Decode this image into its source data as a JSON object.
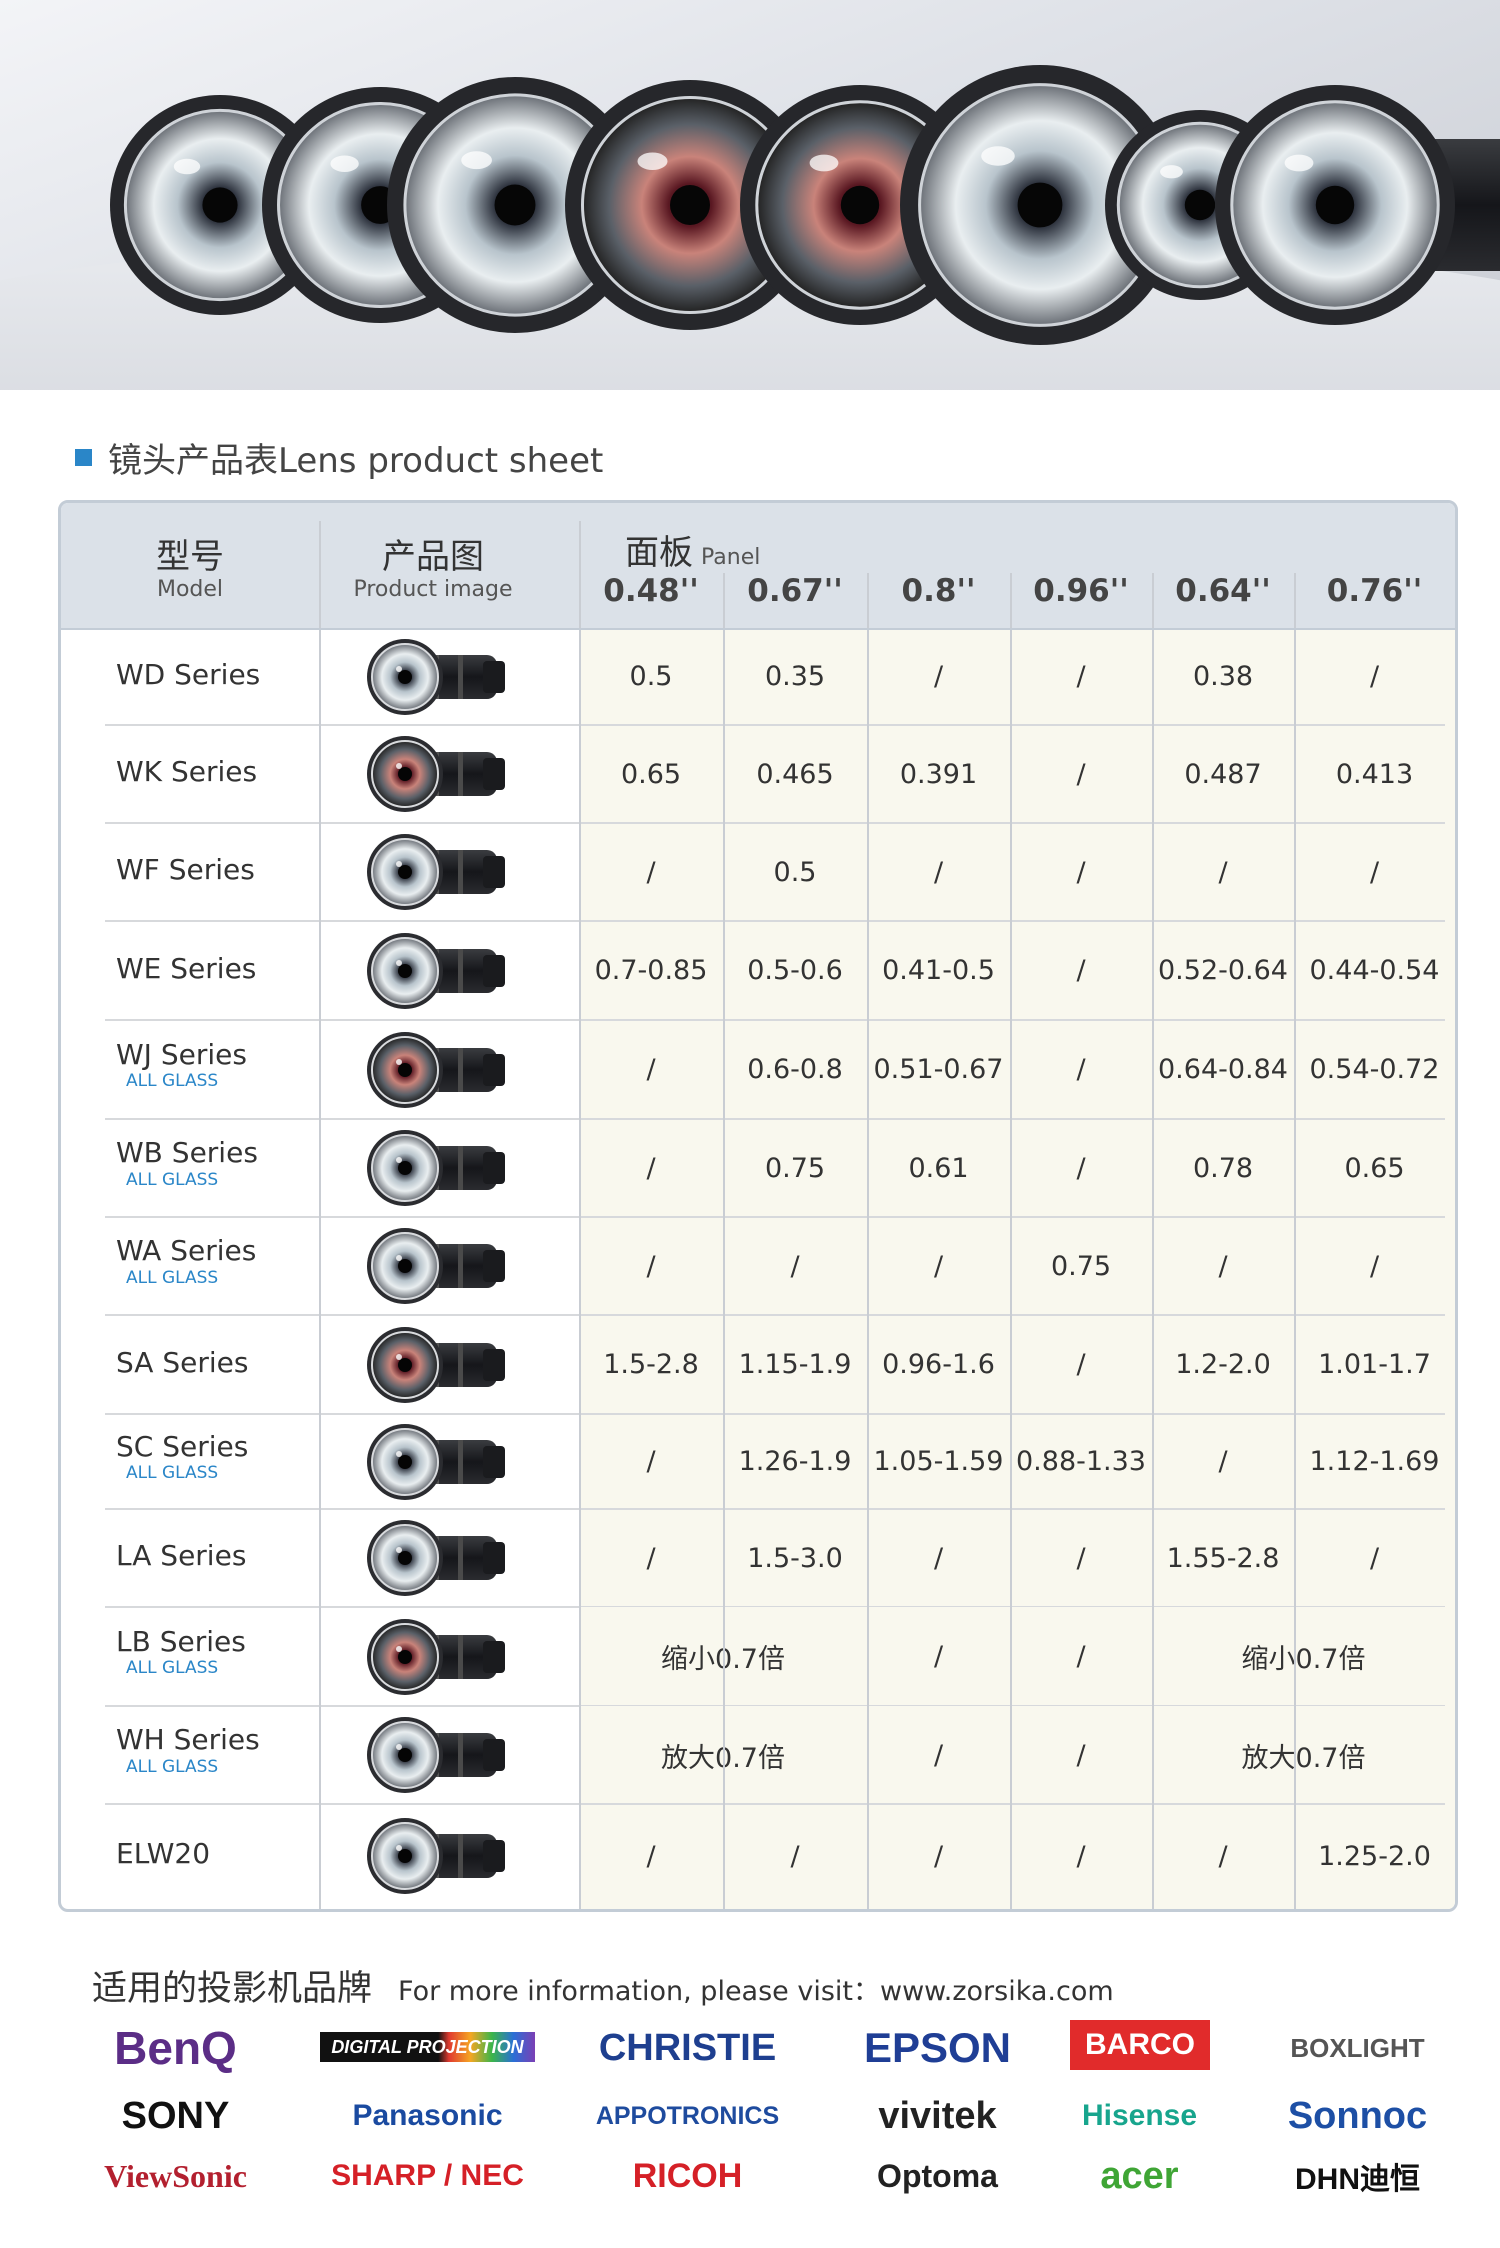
{
  "section_title": "镜头产品表Lens product sheet",
  "table": {
    "header": {
      "model_cn": "型号",
      "model_en": "Model",
      "image_cn": "产品图",
      "image_en": "Product image",
      "panel_cn": "面板",
      "panel_en": "Panel",
      "panel_sizes": [
        "0.48''",
        "0.67''",
        "0.8''",
        "0.96''",
        "0.64''",
        "0.76''"
      ]
    },
    "rows": [
      {
        "name": "WD Series",
        "sub": "",
        "values": [
          "0.5",
          "0.35",
          "/",
          "/",
          "0.38",
          "/"
        ]
      },
      {
        "name": "WK Series",
        "sub": "",
        "values": [
          "0.65",
          "0.465",
          "0.391",
          "/",
          "0.487",
          "0.413"
        ]
      },
      {
        "name": "WF Series",
        "sub": "",
        "values": [
          "/",
          "0.5",
          "/",
          "/",
          "/",
          "/"
        ]
      },
      {
        "name": "WE Series",
        "sub": "",
        "values": [
          "0.7-0.85",
          "0.5-0.6",
          "0.41-0.5",
          "/",
          "0.52-0.64",
          "0.44-0.54"
        ]
      },
      {
        "name": "WJ Series",
        "sub": "ALL GLASS",
        "values": [
          "/",
          "0.6-0.8",
          "0.51-0.67",
          "/",
          "0.64-0.84",
          "0.54-0.72"
        ]
      },
      {
        "name": "WB Series",
        "sub": "ALL GLASS",
        "values": [
          "/",
          "0.75",
          "0.61",
          "/",
          "0.78",
          "0.65"
        ]
      },
      {
        "name": "WA Series",
        "sub": "ALL GLASS",
        "values": [
          "/",
          "/",
          "/",
          "0.75",
          "/",
          "/"
        ]
      },
      {
        "name": "SA Series",
        "sub": "",
        "values": [
          "1.5-2.8",
          "1.15-1.9",
          "0.96-1.6",
          "/",
          "1.2-2.0",
          "1.01-1.7"
        ]
      },
      {
        "name": "SC Series",
        "sub": "ALL GLASS",
        "values": [
          "/",
          "1.26-1.9",
          "1.05-1.59",
          "0.88-1.33",
          "/",
          "1.12-1.69"
        ]
      },
      {
        "name": "LA Series",
        "sub": "",
        "values": [
          "/",
          "1.5-3.0",
          "/",
          "/",
          "1.55-2.8",
          "/"
        ]
      },
      {
        "name": "LB Series",
        "sub": "ALL GLASS",
        "merged": [
          "缩小0.7倍",
          "/",
          "/",
          "缩小0.7倍"
        ]
      },
      {
        "name": "WH Series",
        "sub": "ALL GLASS",
        "merged": [
          "放大0.7倍",
          "/",
          "/",
          "放大0.7倍"
        ]
      },
      {
        "name": "ELW20",
        "sub": "",
        "values": [
          "/",
          "/",
          "/",
          "/",
          "/",
          "1.25-2.0"
        ]
      }
    ]
  },
  "brands_heading_cn": "适用的投影机品牌",
  "brands_heading_en": "For more information, please visit：www.zorsika.com",
  "brands": [
    {
      "name": "BenQ",
      "color": "#5b2d86"
    },
    {
      "name": "DIGITAL PROJECTION",
      "color": "#111111"
    },
    {
      "name": "CHRISTIE",
      "color": "#1e3f8f"
    },
    {
      "name": "EPSON",
      "color": "#1f3e95"
    },
    {
      "name": "BARCO",
      "color": "#e12b2b"
    },
    {
      "name": "BOXLIGHT",
      "color": "#555555"
    },
    {
      "name": "SONY",
      "color": "#111111"
    },
    {
      "name": "Panasonic",
      "color": "#1a4aa0"
    },
    {
      "name": "APPOTRONICS",
      "color": "#1e4b9e"
    },
    {
      "name": "vivitek",
      "color": "#222222"
    },
    {
      "name": "Hisense",
      "color": "#17a58d"
    },
    {
      "name": "Sonnoc",
      "color": "#1d4fa5"
    },
    {
      "name": "ViewSonic",
      "color": "#b3202f"
    },
    {
      "name": "SHARP / NEC",
      "color": "#d52027"
    },
    {
      "name": "RICOH",
      "color": "#d52027"
    },
    {
      "name": "Optoma",
      "color": "#222222"
    },
    {
      "name": "acer",
      "color": "#3fa535"
    },
    {
      "name": "DHN迪恒",
      "color": "#111111"
    }
  ]
}
